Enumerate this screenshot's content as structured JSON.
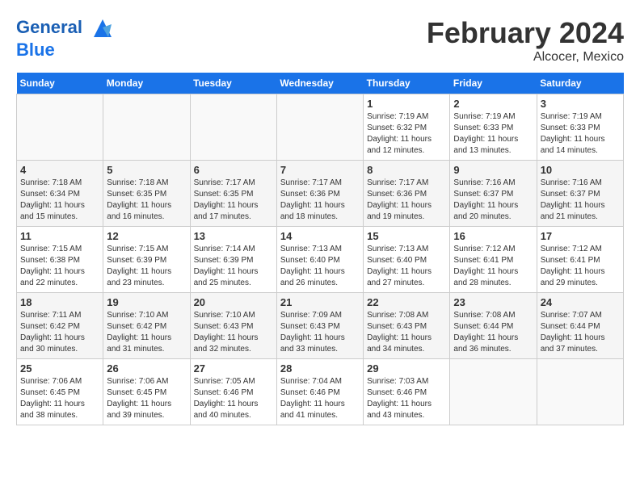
{
  "header": {
    "logo_line1": "General",
    "logo_line2": "Blue",
    "month": "February 2024",
    "location": "Alcocer, Mexico"
  },
  "weekdays": [
    "Sunday",
    "Monday",
    "Tuesday",
    "Wednesday",
    "Thursday",
    "Friday",
    "Saturday"
  ],
  "weeks": [
    [
      {
        "day": "",
        "empty": true
      },
      {
        "day": "",
        "empty": true
      },
      {
        "day": "",
        "empty": true
      },
      {
        "day": "",
        "empty": true
      },
      {
        "day": "1",
        "sunrise": "7:19 AM",
        "sunset": "6:32 PM",
        "daylight": "11 hours and 12 minutes."
      },
      {
        "day": "2",
        "sunrise": "7:19 AM",
        "sunset": "6:33 PM",
        "daylight": "11 hours and 13 minutes."
      },
      {
        "day": "3",
        "sunrise": "7:19 AM",
        "sunset": "6:33 PM",
        "daylight": "11 hours and 14 minutes."
      }
    ],
    [
      {
        "day": "4",
        "sunrise": "7:18 AM",
        "sunset": "6:34 PM",
        "daylight": "11 hours and 15 minutes."
      },
      {
        "day": "5",
        "sunrise": "7:18 AM",
        "sunset": "6:35 PM",
        "daylight": "11 hours and 16 minutes."
      },
      {
        "day": "6",
        "sunrise": "7:17 AM",
        "sunset": "6:35 PM",
        "daylight": "11 hours and 17 minutes."
      },
      {
        "day": "7",
        "sunrise": "7:17 AM",
        "sunset": "6:36 PM",
        "daylight": "11 hours and 18 minutes."
      },
      {
        "day": "8",
        "sunrise": "7:17 AM",
        "sunset": "6:36 PM",
        "daylight": "11 hours and 19 minutes."
      },
      {
        "day": "9",
        "sunrise": "7:16 AM",
        "sunset": "6:37 PM",
        "daylight": "11 hours and 20 minutes."
      },
      {
        "day": "10",
        "sunrise": "7:16 AM",
        "sunset": "6:37 PM",
        "daylight": "11 hours and 21 minutes."
      }
    ],
    [
      {
        "day": "11",
        "sunrise": "7:15 AM",
        "sunset": "6:38 PM",
        "daylight": "11 hours and 22 minutes."
      },
      {
        "day": "12",
        "sunrise": "7:15 AM",
        "sunset": "6:39 PM",
        "daylight": "11 hours and 23 minutes."
      },
      {
        "day": "13",
        "sunrise": "7:14 AM",
        "sunset": "6:39 PM",
        "daylight": "11 hours and 25 minutes."
      },
      {
        "day": "14",
        "sunrise": "7:13 AM",
        "sunset": "6:40 PM",
        "daylight": "11 hours and 26 minutes."
      },
      {
        "day": "15",
        "sunrise": "7:13 AM",
        "sunset": "6:40 PM",
        "daylight": "11 hours and 27 minutes."
      },
      {
        "day": "16",
        "sunrise": "7:12 AM",
        "sunset": "6:41 PM",
        "daylight": "11 hours and 28 minutes."
      },
      {
        "day": "17",
        "sunrise": "7:12 AM",
        "sunset": "6:41 PM",
        "daylight": "11 hours and 29 minutes."
      }
    ],
    [
      {
        "day": "18",
        "sunrise": "7:11 AM",
        "sunset": "6:42 PM",
        "daylight": "11 hours and 30 minutes."
      },
      {
        "day": "19",
        "sunrise": "7:10 AM",
        "sunset": "6:42 PM",
        "daylight": "11 hours and 31 minutes."
      },
      {
        "day": "20",
        "sunrise": "7:10 AM",
        "sunset": "6:43 PM",
        "daylight": "11 hours and 32 minutes."
      },
      {
        "day": "21",
        "sunrise": "7:09 AM",
        "sunset": "6:43 PM",
        "daylight": "11 hours and 33 minutes."
      },
      {
        "day": "22",
        "sunrise": "7:08 AM",
        "sunset": "6:43 PM",
        "daylight": "11 hours and 34 minutes."
      },
      {
        "day": "23",
        "sunrise": "7:08 AM",
        "sunset": "6:44 PM",
        "daylight": "11 hours and 36 minutes."
      },
      {
        "day": "24",
        "sunrise": "7:07 AM",
        "sunset": "6:44 PM",
        "daylight": "11 hours and 37 minutes."
      }
    ],
    [
      {
        "day": "25",
        "sunrise": "7:06 AM",
        "sunset": "6:45 PM",
        "daylight": "11 hours and 38 minutes."
      },
      {
        "day": "26",
        "sunrise": "7:06 AM",
        "sunset": "6:45 PM",
        "daylight": "11 hours and 39 minutes."
      },
      {
        "day": "27",
        "sunrise": "7:05 AM",
        "sunset": "6:46 PM",
        "daylight": "11 hours and 40 minutes."
      },
      {
        "day": "28",
        "sunrise": "7:04 AM",
        "sunset": "6:46 PM",
        "daylight": "11 hours and 41 minutes."
      },
      {
        "day": "29",
        "sunrise": "7:03 AM",
        "sunset": "6:46 PM",
        "daylight": "11 hours and 43 minutes."
      },
      {
        "day": "",
        "empty": true
      },
      {
        "day": "",
        "empty": true
      }
    ]
  ],
  "labels": {
    "sunrise_prefix": "Sunrise: ",
    "sunset_prefix": "Sunset: ",
    "daylight_prefix": "Daylight: "
  }
}
